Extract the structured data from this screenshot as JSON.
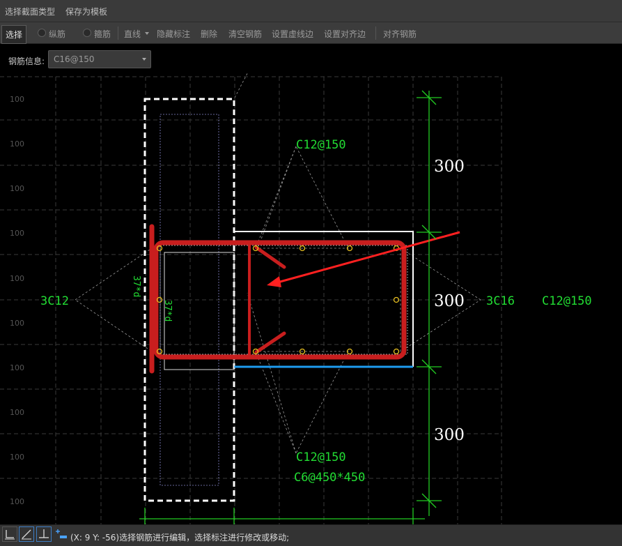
{
  "menu": {
    "section_type": "选择截面类型",
    "save_template": "保存为模板"
  },
  "toolbar": {
    "select": "选择",
    "longitudinal": "纵筋",
    "stirrup": "箍筋",
    "line": "直线",
    "hide_annotation": "隐藏标注",
    "delete": "删除",
    "clear_rebar": "清空钢筋",
    "set_dashed_edge": "设置虚线边",
    "set_align_edge": "设置对齐边",
    "align_rebar": "对齐钢筋"
  },
  "rebar_info": {
    "label": "钢筋信息:",
    "value": "C16@150"
  },
  "grid": {
    "tick_label": "100"
  },
  "dimensions": [
    "300",
    "300",
    "300"
  ],
  "annotations": {
    "top_stirrup": "C12@150",
    "left_rebar": "3C12",
    "right_rebar": "3C16",
    "right_stirrup": "C12@150",
    "bottom_stirrup": "C12@150",
    "bottom_tie": "C6@450*450",
    "anchor_1": "37*d",
    "anchor_2": "37*d"
  },
  "status": {
    "text": "(X: 9 Y: -56)选择钢筋进行编辑，选择标注进行修改或移动;"
  },
  "colors": {
    "rebar": "#c81e1e",
    "annotation": "#22dd33",
    "dimension_line": "#22cc22",
    "outline": "#ffffff",
    "aligned_edge": "#1e9bf0",
    "pointer_arrow": "#ff2020"
  }
}
